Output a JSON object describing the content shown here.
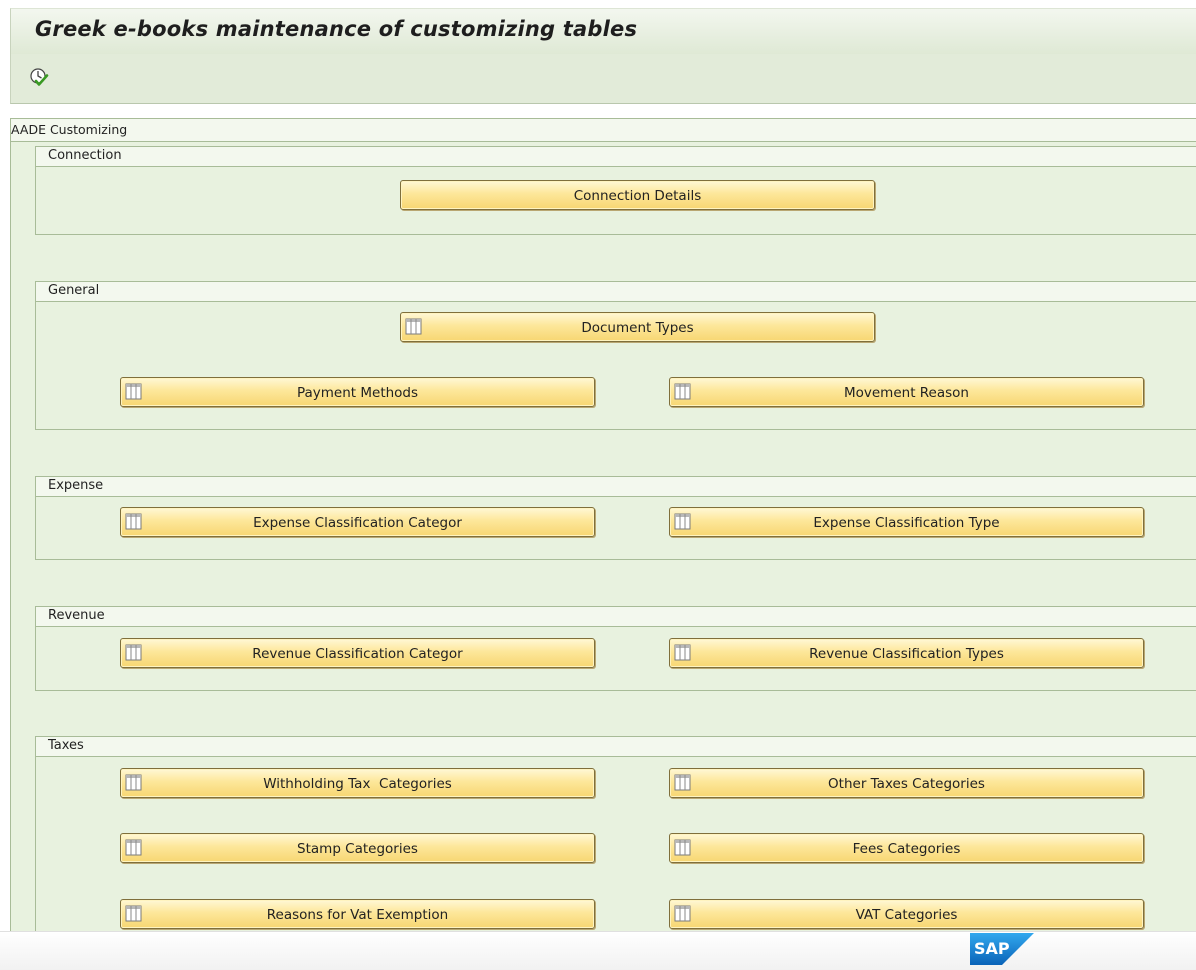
{
  "title": "Greek e-books maintenance of customizing tables",
  "toolbar": {
    "execute_icon": "execute-icon"
  },
  "frame": {
    "title": "AADE Customizing",
    "groups": {
      "connection": {
        "title": "Connection",
        "buttons": [
          "Connection Details"
        ]
      },
      "general": {
        "title": "General",
        "buttons": [
          "Document Types",
          "Payment Methods",
          "Movement Reason"
        ]
      },
      "expense": {
        "title": "Expense",
        "buttons": [
          "Expense Classification Categor",
          "Expense Classification Type"
        ]
      },
      "revenue": {
        "title": "Revenue",
        "buttons": [
          "Revenue Classification Categor",
          "Revenue Classification Types"
        ]
      },
      "taxes": {
        "title": "Taxes",
        "buttons": [
          "Withholding Tax  Categories",
          "Other Taxes Categories",
          "Stamp Categories",
          "Fees Categories",
          "Reasons for Vat Exemption",
          "VAT Categories"
        ]
      }
    }
  },
  "footer": {
    "logo": "SAP"
  },
  "colors": {
    "button_fill": "#fde79a",
    "panel": "#e8f2df",
    "sap_blue": "#1a73c9"
  }
}
